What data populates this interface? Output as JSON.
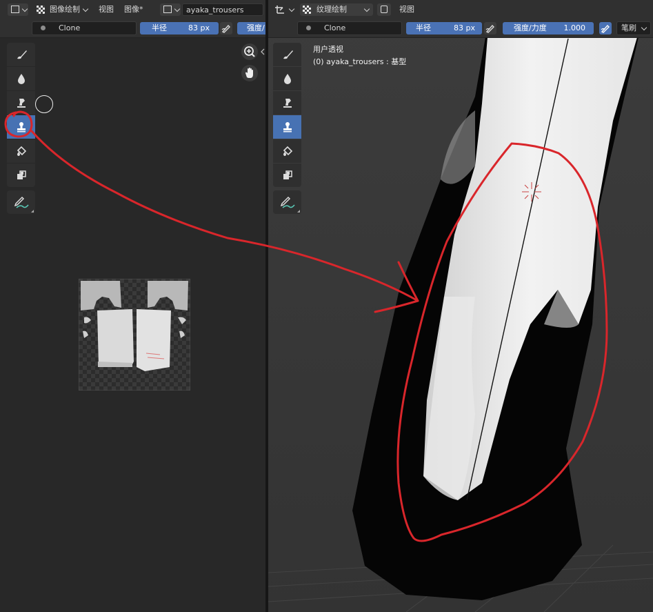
{
  "left_editor": {
    "header": {
      "editor_type_icon": "image-editor-icon",
      "mode_label": "图像绘制",
      "menus": [
        "视图",
        "图像*"
      ],
      "image_name": "ayaka_trousers"
    },
    "tool_header": {
      "brush_name": "Clone",
      "radius_label": "半径",
      "radius_value": "83 px",
      "strength_label": "强度/"
    },
    "tools": [
      "draw-brush-icon",
      "soften-icon",
      "smear-icon",
      "clone-stamp-icon",
      "fill-icon",
      "mask-icon",
      "annotate-icon"
    ]
  },
  "right_editor": {
    "header": {
      "editor_type_icon": "3d-viewport-icon",
      "mode_label": "纹理绘制",
      "menus": [
        "视图"
      ]
    },
    "tool_header": {
      "brush_name": "Clone",
      "radius_label": "半径",
      "radius_value": "83 px",
      "strength_label": "强度/力度",
      "strength_value": "1.000",
      "brush_menu_label": "笔刷"
    },
    "viewport": {
      "view_name": "用户透视",
      "object_info": "(0) ayaka_trousers : 基型"
    },
    "tools": [
      "draw-brush-icon",
      "soften-icon",
      "smear-icon",
      "clone-stamp-icon",
      "fill-icon",
      "mask-icon",
      "annotate-icon"
    ]
  },
  "colors": {
    "accent_blue": "#4a72b5",
    "annotation_red": "#d9262b",
    "panel": "#303030",
    "viewport_bg": "#3b3b3b"
  }
}
